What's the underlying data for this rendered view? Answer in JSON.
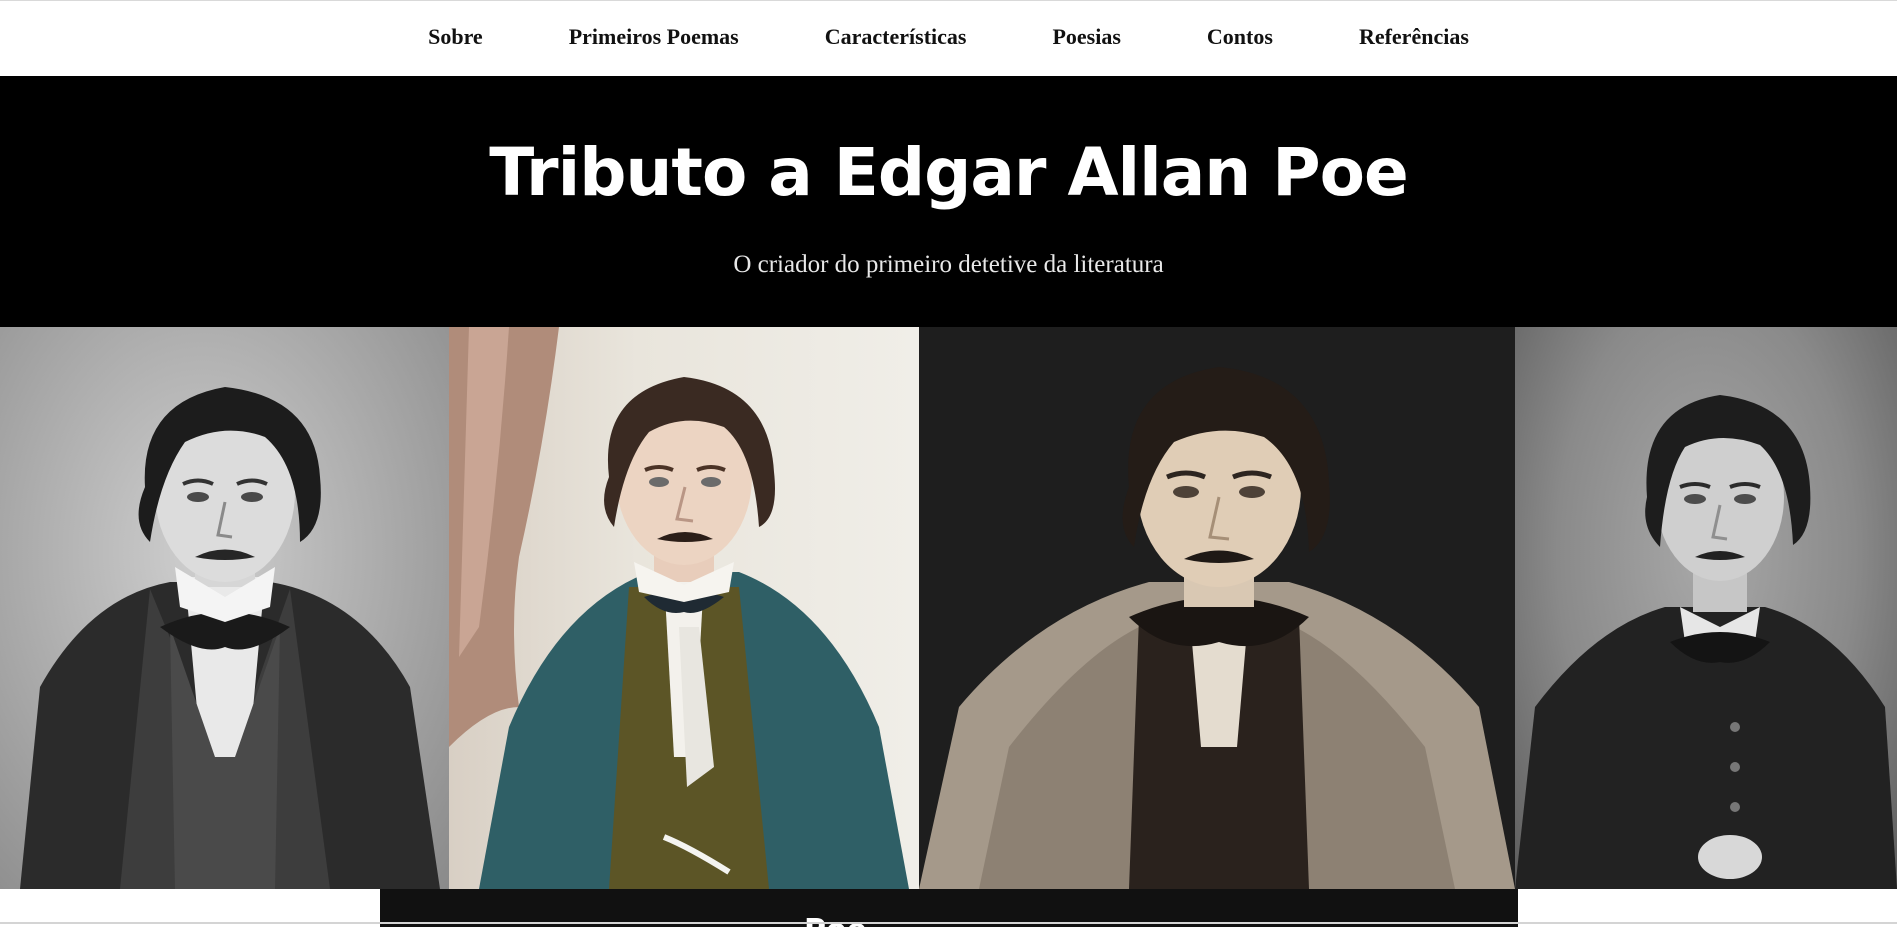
{
  "nav": {
    "items": [
      {
        "label": "Sobre"
      },
      {
        "label": "Primeiros Poemas"
      },
      {
        "label": "Características"
      },
      {
        "label": "Poesias"
      },
      {
        "label": "Contos"
      },
      {
        "label": "Referências"
      }
    ]
  },
  "header": {
    "title": "Tributo a Edgar Allan Poe",
    "subtitle": "O criador do primeiro detetive da literatura"
  },
  "portraits": [
    {
      "icon": "portrait-engraving-bw-icon"
    },
    {
      "icon": "portrait-painting-teal-coat-icon"
    },
    {
      "icon": "portrait-photo-sepia-icon"
    },
    {
      "icon": "portrait-daguerreotype-icon"
    }
  ],
  "section": {
    "heading": "Poe"
  },
  "colors": {
    "nav_bg": "#ffffff",
    "header_bg": "#000000",
    "content_bar_bg": "#111111",
    "text_light": "#ffffff"
  }
}
